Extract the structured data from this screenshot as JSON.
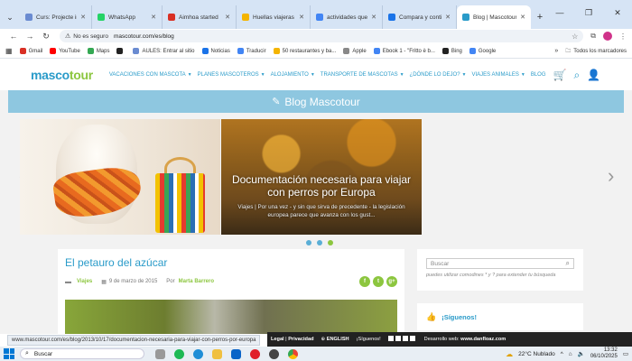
{
  "browser": {
    "tabs": [
      {
        "label": "Curs: Projecte ir",
        "color": "#6a8bd1"
      },
      {
        "label": "WhatsApp",
        "color": "#25d366"
      },
      {
        "label": "Aimhoa started",
        "color": "#d93025"
      },
      {
        "label": "Huellas viajeras",
        "color": "#f4b400"
      },
      {
        "label": "actividades que",
        "color": "#4285f4"
      },
      {
        "label": "Compara y conti",
        "color": "#1a73e8"
      },
      {
        "label": "Blog | Mascotour",
        "color": "#2a9bc9",
        "active": true
      }
    ],
    "new_tab": "+",
    "security_label": "No es seguro",
    "url": "mascotour.com/es/blog",
    "bookmarks": [
      {
        "label": "Gmail",
        "color": "#d93025"
      },
      {
        "label": "YouTube",
        "color": "#ff0000"
      },
      {
        "label": "Maps",
        "color": "#34a853"
      },
      {
        "label": "",
        "color": "#222222"
      },
      {
        "label": "AULES: Entrar al sitio",
        "color": "#6a8bd1"
      },
      {
        "label": "Noticias",
        "color": "#1a73e8"
      },
      {
        "label": "Traducir",
        "color": "#4285f4"
      },
      {
        "label": "50 restaurantes y ba...",
        "color": "#f4b400"
      },
      {
        "label": "Apple",
        "color": "#888888"
      },
      {
        "label": "Ebook 1 - \"Fritto è b...",
        "color": "#4285f4"
      },
      {
        "label": "Bing",
        "color": "#222222"
      },
      {
        "label": "Google",
        "color": "#4285f4"
      }
    ],
    "bookmarks_more": "»",
    "bookmarks_folder": "Todos los marcadores"
  },
  "site": {
    "logo_a": "masco",
    "logo_b": "tour",
    "nav": [
      "VACACIONES CON MASCOTA",
      "PLANES MASCOTEROS",
      "ALOJAMIENTO",
      "TRANSPORTE DE MASCOTAS",
      "¿DÓNDE LO DEJO?",
      "VIAJES ANIMALES"
    ],
    "nav_blog": "BLOG",
    "blog_title": "Blog Mascotour",
    "slide": {
      "title": "Documentación necesaria para viajar con perros por Europa",
      "text": "Viajes | Por una vez - y sin que sirva de precedente - la legislación europea parece que avanza con los gust..."
    },
    "article": {
      "title": "El petauro del azúcar",
      "category": "Viajes",
      "date": "9 de marzo de 2015",
      "by": "Por",
      "author": "Marta Barrero",
      "social": [
        "f",
        "t",
        "g+"
      ]
    },
    "sidebar": {
      "search_placeholder": "Buscar",
      "search_hint": "puedes utilizar comodines * y ? para extender tu búsqueda",
      "follow": "¡Síguenos!"
    },
    "footer": {
      "legal": "Legal",
      "privacy": "Privacidad",
      "english": "ENGLISH",
      "follow": "¡Síguenos!",
      "dev_label": "Desarrollo web:",
      "dev_site": "www.danfloaz.com"
    }
  },
  "status_url": "www.mascotour.com/es/blog/2013/10/17/documentacion-necesaria-para-viajar-con-perros-por-europa",
  "taskbar": {
    "search_label": "Buscar",
    "weather": "22°C  Nublado",
    "time": "13:32",
    "date": "06/10/2025"
  }
}
